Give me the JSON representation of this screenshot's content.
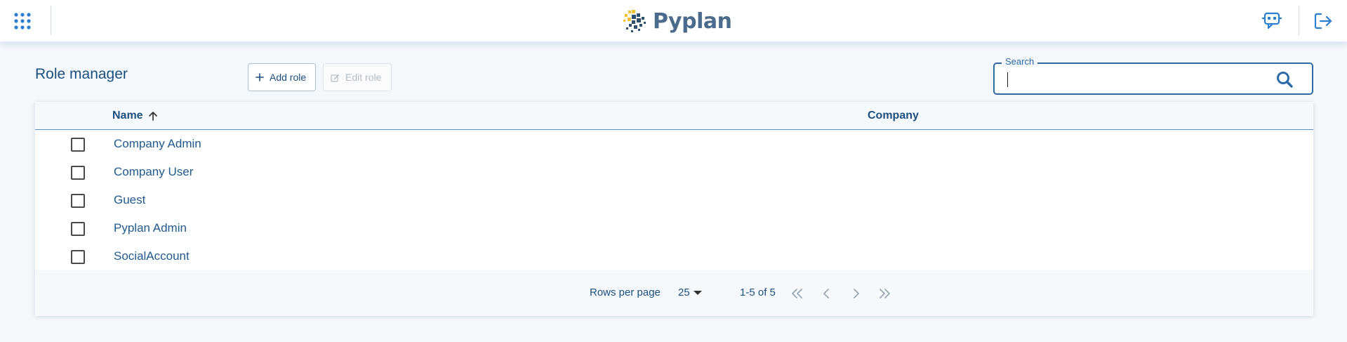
{
  "app": {
    "logo_text": "Pyplan"
  },
  "header": {
    "apps_icon": "apps-grid-icon",
    "assistant_icon": "assistant-chat-icon",
    "logout_icon": "logout-icon"
  },
  "page": {
    "title": "Role manager",
    "add_label": "Add role",
    "edit_label": "Edit role"
  },
  "search": {
    "label": "Search",
    "value": "",
    "placeholder": ""
  },
  "table": {
    "columns": [
      "Name",
      "Company"
    ],
    "sort": {
      "column": "Name",
      "direction": "ascending"
    },
    "rows": [
      {
        "name": "Company Admin",
        "company": ""
      },
      {
        "name": "Company User",
        "company": ""
      },
      {
        "name": "Guest",
        "company": ""
      },
      {
        "name": "Pyplan Admin",
        "company": ""
      },
      {
        "name": "SocialAccount",
        "company": ""
      }
    ]
  },
  "pagination": {
    "rows_per_page_label": "Rows per page",
    "rows_per_page": "25",
    "range": "1-5 of 5"
  },
  "colors": {
    "primary": "#1f5a8e",
    "accent": "#2d6aa8",
    "logo_yellow": "#f2c230",
    "background": "#f4f7fb"
  }
}
